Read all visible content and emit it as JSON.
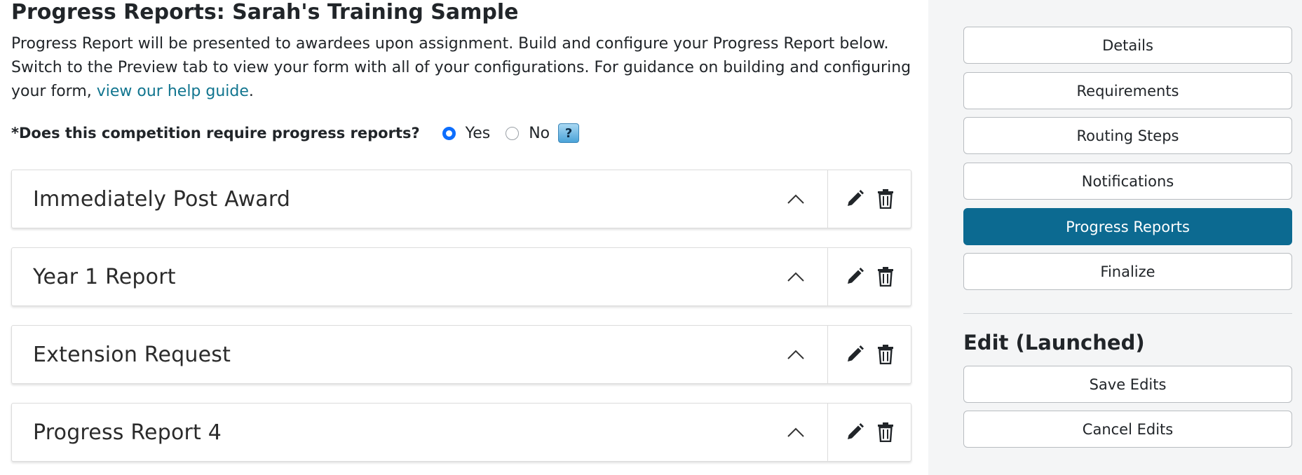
{
  "page": {
    "title": "Progress Reports: Sarah's Training Sample",
    "description_text": "Progress Report will be presented to awardees upon assignment. Build and configure your Progress Report below. Switch to the Preview tab to view your form with all of your configurations. For guidance on building and configuring your form, ",
    "help_link_text": "view our help guide",
    "description_end": "."
  },
  "question": {
    "label": "*Does this competition require progress reports?",
    "options": [
      {
        "label": "Yes",
        "checked": true
      },
      {
        "label": "No",
        "checked": false
      }
    ],
    "help_label": "?"
  },
  "reports": [
    {
      "title": "Immediately Post Award"
    },
    {
      "title": "Year 1 Report"
    },
    {
      "title": "Extension Request"
    },
    {
      "title": "Progress Report 4"
    }
  ],
  "sidebar": {
    "nav": [
      {
        "label": "Details",
        "active": false
      },
      {
        "label": "Requirements",
        "active": false
      },
      {
        "label": "Routing Steps",
        "active": false
      },
      {
        "label": "Notifications",
        "active": false
      },
      {
        "label": "Progress Reports",
        "active": true
      },
      {
        "label": "Finalize",
        "active": false
      }
    ],
    "edit_title": "Edit (Launched)",
    "save_label": "Save Edits",
    "cancel_label": "Cancel Edits"
  },
  "colors": {
    "accent": "#0c6a91",
    "link": "#11758f",
    "radio_checked": "#0d6efd",
    "sidebar_bg": "#f4f5f6"
  },
  "icons": [
    "chevron-up-icon",
    "pencil-icon",
    "trash-icon",
    "help-icon"
  ]
}
